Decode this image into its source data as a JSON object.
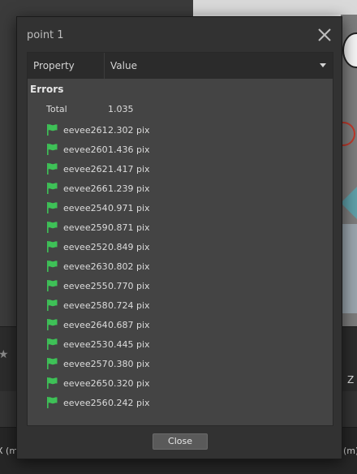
{
  "background": {
    "zlabel": "Z (",
    "footer_left": "X (m",
    "footer_right": "(m)"
  },
  "dialog": {
    "title": "point 1",
    "table": {
      "col_property": "Property",
      "col_value": "Value"
    },
    "group": "Errors",
    "total": {
      "name": "Total",
      "value": "1.035"
    },
    "errors": [
      {
        "name": "eevee261",
        "value": "2.302 pix"
      },
      {
        "name": "eevee260",
        "value": "1.436 pix"
      },
      {
        "name": "eevee262",
        "value": "1.417 pix"
      },
      {
        "name": "eevee266",
        "value": "1.239 pix"
      },
      {
        "name": "eevee254",
        "value": "0.971 pix"
      },
      {
        "name": "eevee259",
        "value": "0.871 pix"
      },
      {
        "name": "eevee252",
        "value": "0.849 pix"
      },
      {
        "name": "eevee263",
        "value": "0.802 pix"
      },
      {
        "name": "eevee255",
        "value": "0.770 pix"
      },
      {
        "name": "eevee258",
        "value": "0.724 pix"
      },
      {
        "name": "eevee264",
        "value": "0.687 pix"
      },
      {
        "name": "eevee253",
        "value": "0.445 pix"
      },
      {
        "name": "eevee257",
        "value": "0.380 pix"
      },
      {
        "name": "eevee265",
        "value": "0.320 pix"
      },
      {
        "name": "eevee256",
        "value": "0.242 pix"
      }
    ],
    "close_label": "Close"
  },
  "colors": {
    "flag_green": "#3ec157",
    "dialog_bg": "#323232",
    "panel_bg": "#444444"
  },
  "icons": {
    "row_icon": "green-flag-icon",
    "close": "close-x-icon",
    "header_dropdown": "caret-down-icon",
    "toolbar": "star-icon"
  }
}
